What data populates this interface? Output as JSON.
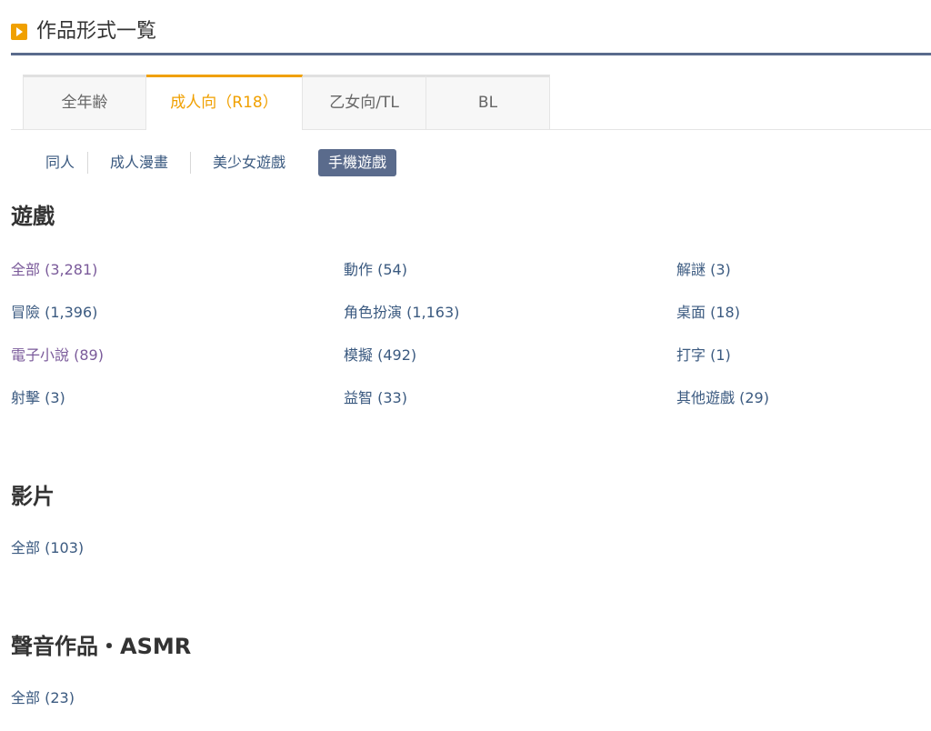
{
  "header": {
    "title": "作品形式一覧"
  },
  "tabs": [
    {
      "label": "全年齢"
    },
    {
      "label": "成人向（R18）"
    },
    {
      "label": "乙女向/TL"
    },
    {
      "label": "BL"
    }
  ],
  "subnav": [
    {
      "label": "同人"
    },
    {
      "label": "成人漫畫"
    },
    {
      "label": "美少女遊戲"
    },
    {
      "label": "手機遊戲"
    }
  ],
  "sections": {
    "games": {
      "title": "遊戲",
      "items": [
        [
          "全部 (3,281)",
          "動作 (54)",
          "解謎 (3)"
        ],
        [
          "冒險 (1,396)",
          "角色扮演 (1,163)",
          "桌面 (18)"
        ],
        [
          "電子小說 (89)",
          "模擬 (492)",
          "打字 (1)"
        ],
        [
          "射擊 (3)",
          "益智 (33)",
          "其他遊戲 (29)"
        ]
      ]
    },
    "video": {
      "title": "影片",
      "items": [
        "全部 (103)"
      ]
    },
    "voice": {
      "title": "聲音作品・ASMR",
      "items": [
        "全部 (23)"
      ]
    }
  },
  "colors": {
    "accent": "#f0a000",
    "link": "#3b5a80",
    "visited": "#7a5a9a",
    "nav_active_bg": "#5a6b8c"
  }
}
